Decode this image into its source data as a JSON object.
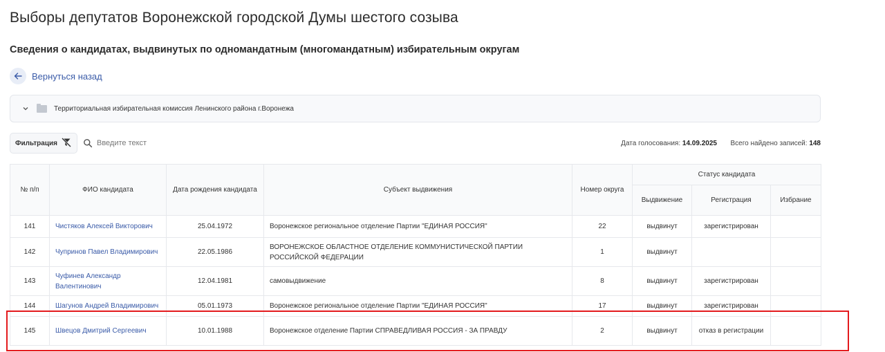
{
  "page": {
    "title": "Выборы депутатов Воронежской городской Думы шестого созыва",
    "subtitle": "Сведения о кандидатах, выдвинутых по одномандатным (многомандатным) избирательным округам"
  },
  "back": {
    "label": "Вернуться назад"
  },
  "accordion": {
    "label": "Территориальная избирательная комиссия Ленинского района г.Воронежа"
  },
  "toolbar": {
    "filter_label": "Фильтрация",
    "search_placeholder": "Введите текст",
    "vote_date_label": "Дата голосования:",
    "vote_date": "14.09.2025",
    "found_label": "Всего найдено записей:",
    "found_count": "148"
  },
  "table": {
    "headers": {
      "num": "№ п/п",
      "name": "ФИО кандидата",
      "birth": "Дата рождения кандидата",
      "subject": "Субъект выдвижения",
      "district": "Номер округа",
      "status": "Статус кандидата",
      "nomination": "Выдвижение",
      "registration": "Регистрация",
      "election": "Избрание"
    },
    "rows": [
      {
        "num": "141",
        "name": "Чистяков Алексей Викторович",
        "birth": "25.04.1972",
        "subject": "Воронежское региональное отделение Партии \"ЕДИНАЯ РОССИЯ\"",
        "district": "22",
        "nomination": "выдвинут",
        "registration": "зарегистрирован",
        "election": ""
      },
      {
        "num": "142",
        "name": "Чупринов Павел Владимирович",
        "birth": "22.05.1986",
        "subject": "ВОРОНЕЖСКОЕ ОБЛАСТНОЕ ОТДЕЛЕНИЕ КОММУНИСТИЧЕСКОЙ ПАРТИИ РОССИЙСКОЙ ФЕДЕРАЦИИ",
        "district": "1",
        "nomination": "выдвинут",
        "registration": "",
        "election": ""
      },
      {
        "num": "143",
        "name": "Чуфинев Александр Валентинович",
        "birth": "12.04.1981",
        "subject": "самовыдвижение",
        "district": "8",
        "nomination": "выдвинут",
        "registration": "зарегистрирован",
        "election": ""
      },
      {
        "num": "144",
        "name": "Шагунов Андрей Владимирович",
        "birth": "05.01.1973",
        "subject": "Воронежское региональное отделение Партии \"ЕДИНАЯ РОССИЯ\"",
        "district": "17",
        "nomination": "выдвинут",
        "registration": "зарегистрирован",
        "election": ""
      },
      {
        "num": "145",
        "name": "Швецов Дмитрий Сергеевич",
        "birth": "10.01.1988",
        "subject": "Воронежское отделение Партии СПРАВЕДЛИВАЯ РОССИЯ - ЗА ПРАВДУ",
        "district": "2",
        "nomination": "выдвинут",
        "registration": "отказ в регистрации",
        "election": ""
      }
    ]
  },
  "colors": {
    "link": "#3a5ba8",
    "highlight": "#e3191c",
    "border": "#e6e8ec"
  }
}
